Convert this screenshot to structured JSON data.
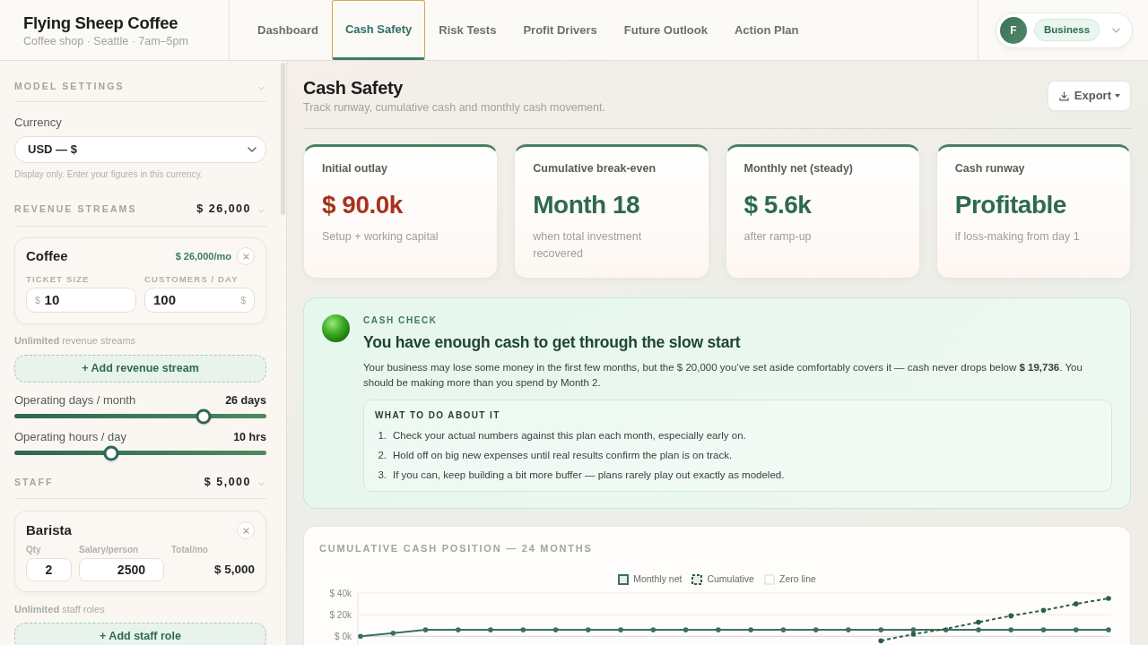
{
  "brand": {
    "name": "Flying Sheep Coffee",
    "subtitle": "Coffee shop · Seattle · 7am–5pm"
  },
  "tabs": [
    {
      "label": "Dashboard",
      "selected": false
    },
    {
      "label": "Cash Safety",
      "selected": true
    },
    {
      "label": "Risk Tests",
      "selected": false
    },
    {
      "label": "Profit Drivers",
      "selected": false
    },
    {
      "label": "Future Outlook",
      "selected": false
    },
    {
      "label": "Action Plan",
      "selected": false
    }
  ],
  "account": {
    "avatar_letter": "F",
    "plan": "Business"
  },
  "sidebar": {
    "model_settings": {
      "title": "MODEL SETTINGS",
      "currency_label": "Currency",
      "currency_value": "USD — $",
      "help": "Display only. Enter your figures in this currency."
    },
    "revenue": {
      "title": "REVENUE STREAMS",
      "total": "$ 26,000",
      "streams": [
        {
          "name": "Coffee",
          "monthly": "$ 26,000/mo",
          "fields": [
            {
              "label": "TICKET SIZE",
              "prefix": "$",
              "value": "10"
            },
            {
              "label": "CUSTOMERS / DAY",
              "value": "100",
              "suffix": "$"
            }
          ]
        }
      ],
      "note": "**Unlimited** revenue streams",
      "add_button": "+ Add revenue stream"
    },
    "sliders": [
      {
        "label": "Operating days / month",
        "reading": "26 days",
        "level": 0.75
      },
      {
        "label": "Operating hours / day",
        "reading": "10 hrs",
        "level": 0.385
      }
    ],
    "staff": {
      "title": "STAFF",
      "total": "$ 5,000",
      "roles": [
        {
          "name": "Barista",
          "qty_label": "Qty",
          "qty": "2",
          "salary_label": "Salary/person",
          "salary": "2500",
          "total_label": "Total/mo",
          "total": "$ 5,000"
        }
      ],
      "note": "**Unlimited** staff roles",
      "add_button": "+ Add staff role"
    }
  },
  "page": {
    "title": "Cash Safety",
    "subtitle": "Track runway, cumulative cash and monthly cash movement.",
    "export_label": "Export"
  },
  "metrics": [
    {
      "label": "Initial outlay",
      "value": "$ 90.0k",
      "negative": true,
      "note": "Setup + working capital"
    },
    {
      "label": "Cumulative break-even",
      "value": "Month 18",
      "negative": false,
      "note": "when total investment recovered"
    },
    {
      "label": "Monthly net (steady)",
      "value": "$ 5.6k",
      "negative": false,
      "note": "after ramp-up"
    },
    {
      "label": "Cash runway",
      "value": "Profitable",
      "negative": false,
      "note": "if loss-making from day 1"
    }
  ],
  "cash_check": {
    "safe": true,
    "eyebrow": "CASH CHECK",
    "headline": "You have enough cash to get through the slow start",
    "body": "Your business may lose some money in the first few months, but the $ 20,000 you’ve set aside comfortably covers it — cash never drops below **$ 19,736**. You should be making more than you spend by Month 2.",
    "actions_title": "WHAT TO DO ABOUT IT",
    "actions": [
      {
        "number": "1.",
        "text": "Check your actual numbers against this plan each month, especially early on."
      },
      {
        "number": "2.",
        "text": "Hold off on big new expenses until real results confirm the plan is on track."
      },
      {
        "number": "3.",
        "text": "If you can, keep building a bit more buffer — plans rarely play out exactly as modeled."
      }
    ]
  },
  "chart": {
    "title": "CUMULATIVE CASH POSITION — 24 MONTHS",
    "chart_data": {
      "type": "line",
      "legend": true,
      "series": [
        {
          "name": "Monthly net",
          "color": "#3d6e62",
          "line_style": "solid",
          "marker": true,
          "values": [
            0,
            3,
            6,
            6,
            6,
            6,
            6,
            6,
            6,
            6,
            6,
            6,
            6,
            6,
            6,
            6,
            6,
            6,
            6,
            6,
            6,
            6,
            6,
            6
          ]
        },
        {
          "name": "Cumulative",
          "color": "#2e5e48",
          "line_style": "dashed",
          "marker": true,
          "values": [
            null,
            null,
            null,
            null,
            null,
            null,
            null,
            null,
            null,
            null,
            null,
            null,
            null,
            null,
            null,
            null,
            -4,
            2,
            7,
            13,
            19,
            24,
            30,
            35
          ]
        },
        {
          "name": "Zero line",
          "color": "#d6d6d0",
          "line_style": "solid",
          "marker": false,
          "values": [
            0,
            0,
            0,
            0,
            0,
            0,
            0,
            0,
            0,
            0,
            0,
            0,
            0,
            0,
            0,
            0,
            0,
            0,
            0,
            0,
            0,
            0,
            0,
            0
          ]
        }
      ],
      "ylim": [
        -8,
        40
      ],
      "yticks": [
        {
          "value": 40,
          "label": "$ 40k"
        },
        {
          "value": 20,
          "label": "$ 20k"
        },
        {
          "value": 0,
          "label": "$ 0k"
        }
      ]
    }
  }
}
